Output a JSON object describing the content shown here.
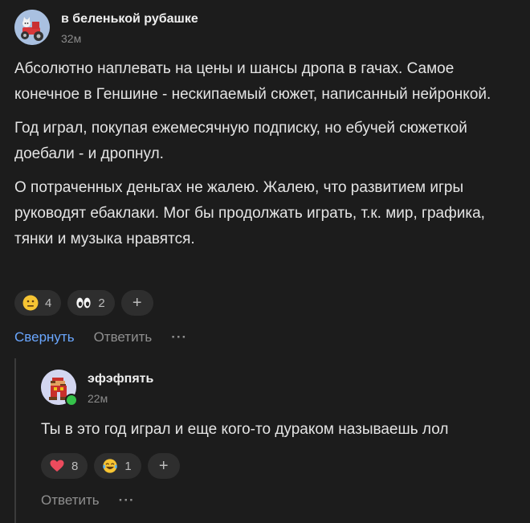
{
  "comment": {
    "author": "в беленькой рубашке",
    "time": "32м",
    "paragraphs": [
      "Абсолютно наплевать на цены и шансы дропа в гачах. Самое конечное в Геншине - нескипаемый сюжет, написанный нейронкой.",
      "Год играл, покупая ежемесячную подписку, но ебучей сюжеткой доебали - и дропнул.",
      "О потраченных деньгах не жалею. Жалею, что развитием игры руководят ебаклаки. Мог бы продолжать играть, т.к. мир, графика, тянки и музыка нравятся."
    ],
    "reactions": [
      {
        "icon": "neutral-face-emoji",
        "count": "4"
      },
      {
        "icon": "eyes-emoji",
        "count": "2"
      }
    ],
    "add_reaction": "+",
    "actions": {
      "collapse": "Свернуть",
      "reply": "Ответить",
      "more": "···"
    }
  },
  "reply": {
    "author": "эфэфпять",
    "time": "22м",
    "text": "Ты в это год играл и еще кого-то дураком называешь лол",
    "reactions": [
      {
        "icon": "heart-emoji",
        "count": "8"
      },
      {
        "icon": "laughing-face-emoji",
        "count": "1"
      }
    ],
    "add_reaction": "+",
    "actions": {
      "reply": "Ответить",
      "more": "···"
    },
    "online_color": "#35c24a"
  },
  "colors": {
    "background": "#1c1c1c",
    "accent_link": "#6aa7ff",
    "pill": "#2e2e2e"
  }
}
